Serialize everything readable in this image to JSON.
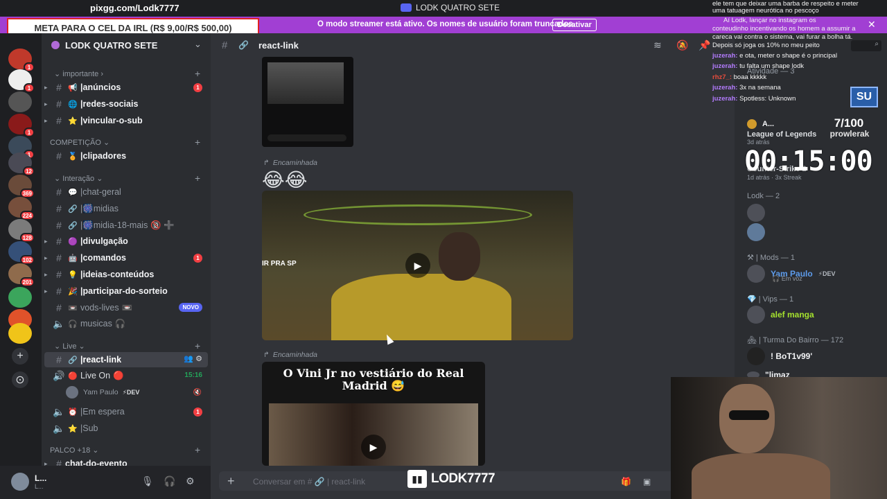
{
  "window": {
    "overlay_url": "pixgg.com/Lodk7777",
    "title": "LODK QUATRO SETE"
  },
  "banner": {
    "goal": "META PARA O CEL DA IRL (R$ 9,00/R$ 500,00)",
    "message": "O modo streamer está ativo. Os nomes de usuário foram truncados.",
    "disable_label": "Desativar"
  },
  "rail": {
    "badges": [
      "1",
      "1",
      "1",
      "1",
      "12",
      "369",
      "224",
      "128",
      "102",
      "201"
    ]
  },
  "server": {
    "name": "LODK QUATRO SETE"
  },
  "categories": {
    "importante": "importante",
    "competicao": "COMPETIÇÃO",
    "interacao": "Interação",
    "live": "Live",
    "palco": "PALCO +18"
  },
  "channels": {
    "anuncios": {
      "label": "anúncios",
      "emoji": "📢",
      "badge": "1"
    },
    "redes": {
      "label": "redes-sociais",
      "emoji": "🌐"
    },
    "vincular": {
      "label": "vincular-o-sub",
      "emoji": "⭐"
    },
    "clipadores": {
      "label": "clipadores",
      "emoji": "🏅"
    },
    "chat_geral": {
      "label": "chat-geral",
      "emoji": "💬"
    },
    "midias": {
      "label": "midias",
      "emoji": "🎆"
    },
    "midia18": {
      "label": "midia-18-mais",
      "emoji": "🎆",
      "suffix": "🔞 ➕"
    },
    "divulgacao": {
      "label": "divulgação",
      "emoji": "🟣"
    },
    "comandos": {
      "label": "comandos",
      "emoji": "🤖",
      "badge": "1"
    },
    "ideias": {
      "label": "ideias-conteúdos",
      "emoji": "💡"
    },
    "sorteio": {
      "label": "participar-do-sorteio",
      "emoji": "🎉"
    },
    "vods": {
      "label": "vods-lives",
      "emoji": "📼",
      "suffix": "📼",
      "tag": "NOVO"
    },
    "musicas": {
      "label": "musicas",
      "emoji": "🎧",
      "suffix": "🎧"
    },
    "react_link": {
      "label": "react-link"
    },
    "live_on": {
      "label": "Live On",
      "emoji": "🔴",
      "suffix": "🔴",
      "time": "15:16"
    },
    "live_user": {
      "name": "Yam Paulo",
      "tag": "DEV"
    },
    "em_espera": {
      "label": "Em espera",
      "emoji": "⏰",
      "badge": "1"
    },
    "sub": {
      "label": "Sub",
      "emoji": "⭐"
    },
    "chat_evento": {
      "label": "chat-do-evento"
    }
  },
  "user_panel": {
    "name": "L...",
    "status": "L..."
  },
  "chat": {
    "channel": "react-link",
    "forwarded_label": "Encaminhada",
    "emojis": "😂😂",
    "video1_text": "IR PRA SP",
    "video2_title": "O Vini Jr no vestiário do Real Madrid 😅",
    "composer_placeholder": "Conversar em # 🔗 | react-link",
    "twitch_name": "LODK7777"
  },
  "members": {
    "activity_heading": "Atividade — 3",
    "activity_game": "League of Legends",
    "activity_time1": "3d atrás",
    "activity_cs": "Counter-Strike 2",
    "activity_time2": "1d atrás",
    "streak": "3x Streak",
    "lodk_heading": "Lodk — 2",
    "mods_heading": "| Mods — 1",
    "mod_name": "Yam Paulo",
    "mod_tag": "DEV",
    "mod_status": "Em voz",
    "vips_heading": "| Vips — 1",
    "vip_name": "alef manga",
    "bairro_heading": "| Turma Do Bairro — 172",
    "bairro_user": "! BoT1v99'",
    "bairro_user2": "\"limaz"
  },
  "overlay": {
    "counter": "7/100",
    "counter_name": "prowlerak",
    "timer": "00:15:00",
    "chat_lines": [
      {
        "user": "",
        "text": "ele tem que deixar uma barba de respeito e meter"
      },
      {
        "user": "",
        "text": "uma tatuagem neurótica no pescoço"
      },
      {
        "user": "",
        "text": "Aí Lodk, lançar no instagram os"
      },
      {
        "user": "",
        "text": "conteudinho incentivando os homem a assumir a"
      },
      {
        "user": "",
        "text": "careca vai contra o sistema, vai furar a bolha tá."
      },
      {
        "user": "",
        "text": "Depois só joga os 10% no meu peito"
      },
      {
        "user": "juzerah:",
        "text": "e ota, meter o shape é o principal"
      },
      {
        "user": "juzerah:",
        "text": "tu falta um shape lodk"
      },
      {
        "user": "rhz7_:",
        "text": "boaa kkkkk"
      },
      {
        "user": "juzerah:",
        "text": "3x na semana"
      },
      {
        "user": "juzerah:",
        "text": "Spotless: Unknown"
      }
    ]
  },
  "colors": {
    "banner": "#a13fd3",
    "accent": "#5865f2",
    "badge": "#f23f43",
    "dev": "#23a55a"
  }
}
